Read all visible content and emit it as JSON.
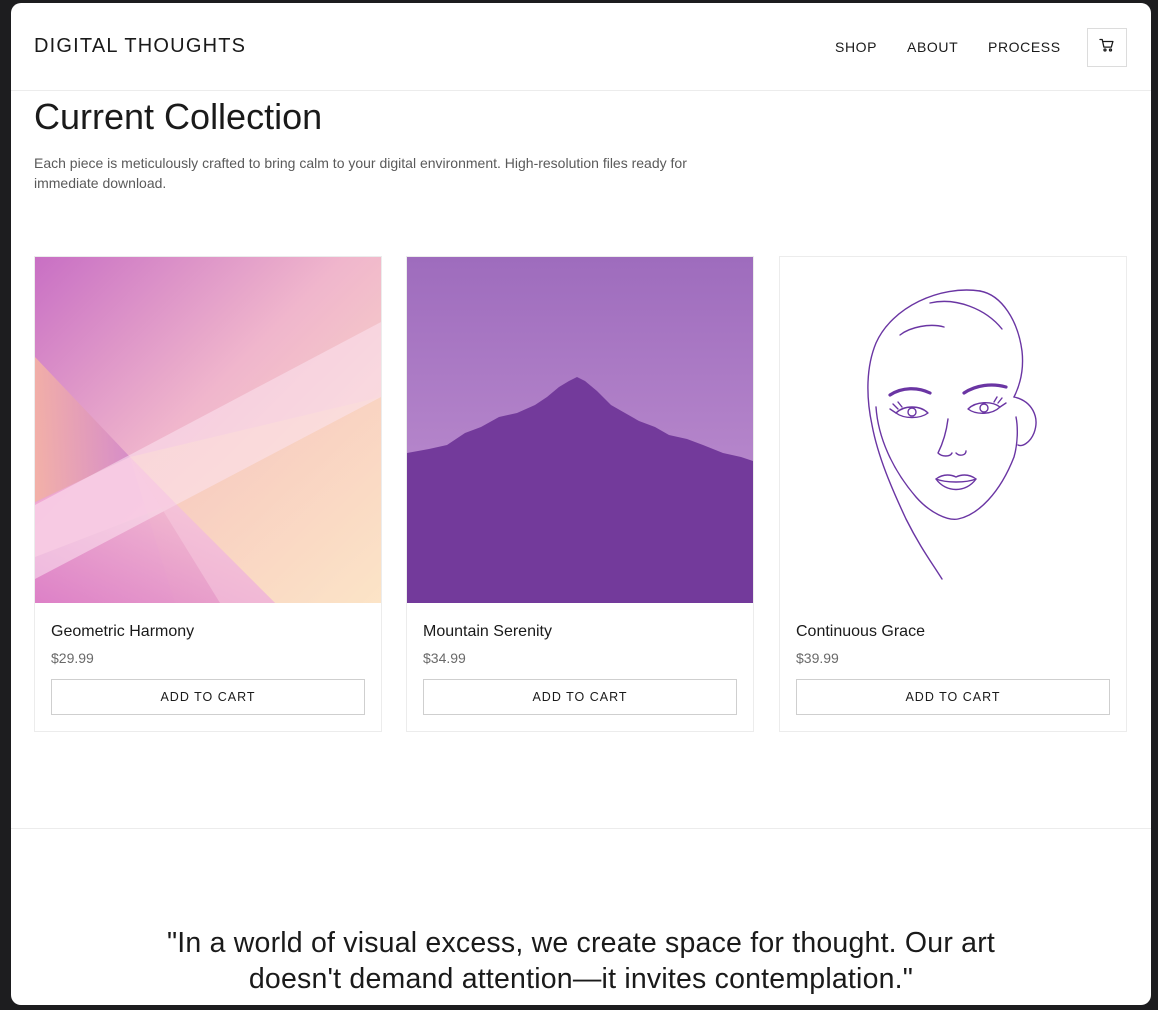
{
  "header": {
    "brand": "DIGITAL THOUGHTS",
    "nav": {
      "shop": "SHOP",
      "about": "ABOUT",
      "process": "PROCESS"
    },
    "cart_icon": "cart-icon"
  },
  "main": {
    "title": "Current Collection",
    "intro": "Each piece is meticulously crafted to bring calm to your digital environment. High-resolution files ready for immediate download.",
    "products": [
      {
        "name": "Geometric Harmony",
        "price": "$29.99",
        "button": "ADD TO CART"
      },
      {
        "name": "Mountain Serenity",
        "price": "$34.99",
        "button": "ADD TO CART"
      },
      {
        "name": "Continuous Grace",
        "price": "$39.99",
        "button": "ADD TO CART"
      }
    ]
  },
  "quote": "\"In a world of visual excess, we create space for thought. Our art doesn't demand attention—it invites contemplation.\"",
  "colors": {
    "accent_purple": "#6f3a9a",
    "mountain_sky": "#a878c4",
    "line_art": "#6a35a3",
    "border": "#ececec"
  }
}
